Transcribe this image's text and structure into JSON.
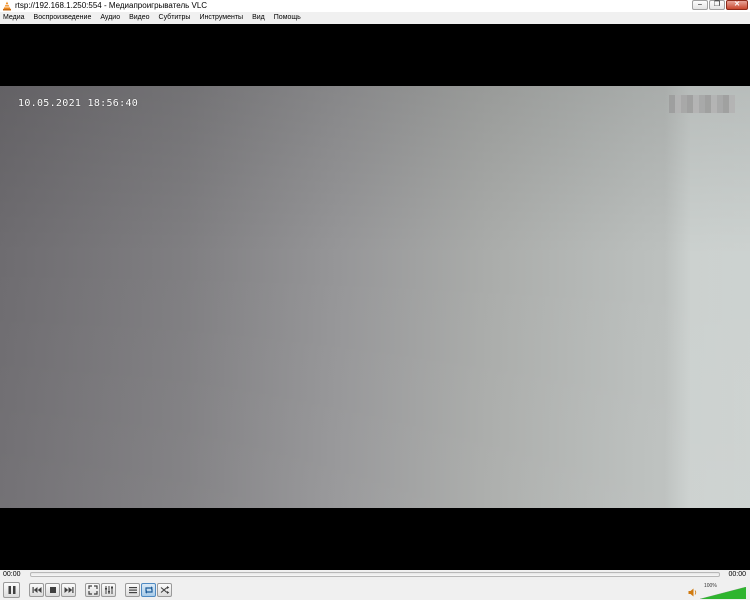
{
  "window": {
    "title": "rtsp://192.168.1.250:554 - Медиапроигрыватель VLC",
    "minimize_symbol": "–",
    "restore_symbol": "❐",
    "close_symbol": "✕"
  },
  "menu": {
    "items": [
      "Медиа",
      "Воспроизведение",
      "Аудио",
      "Видео",
      "Субтитры",
      "Инструменты",
      "Вид",
      "Помощь"
    ]
  },
  "video": {
    "osd_timestamp": "10.05.2021 18:56:40"
  },
  "controls": {
    "time_elapsed": "00:00",
    "time_total": "00:00",
    "seek_position": 0,
    "volume_label": "100%",
    "volume_level": 1.0,
    "icons": [
      "pause-icon",
      "previous-icon",
      "stop-icon",
      "next-icon",
      "fullscreen-icon",
      "extended-settings-icon",
      "playlist-icon",
      "loop-icon",
      "shuffle-icon",
      "speaker-icon"
    ]
  },
  "colors": {
    "vlc_orange": "#f08a1c",
    "volume_green": "#2fb52f",
    "active_button": "#a9cbe8"
  }
}
